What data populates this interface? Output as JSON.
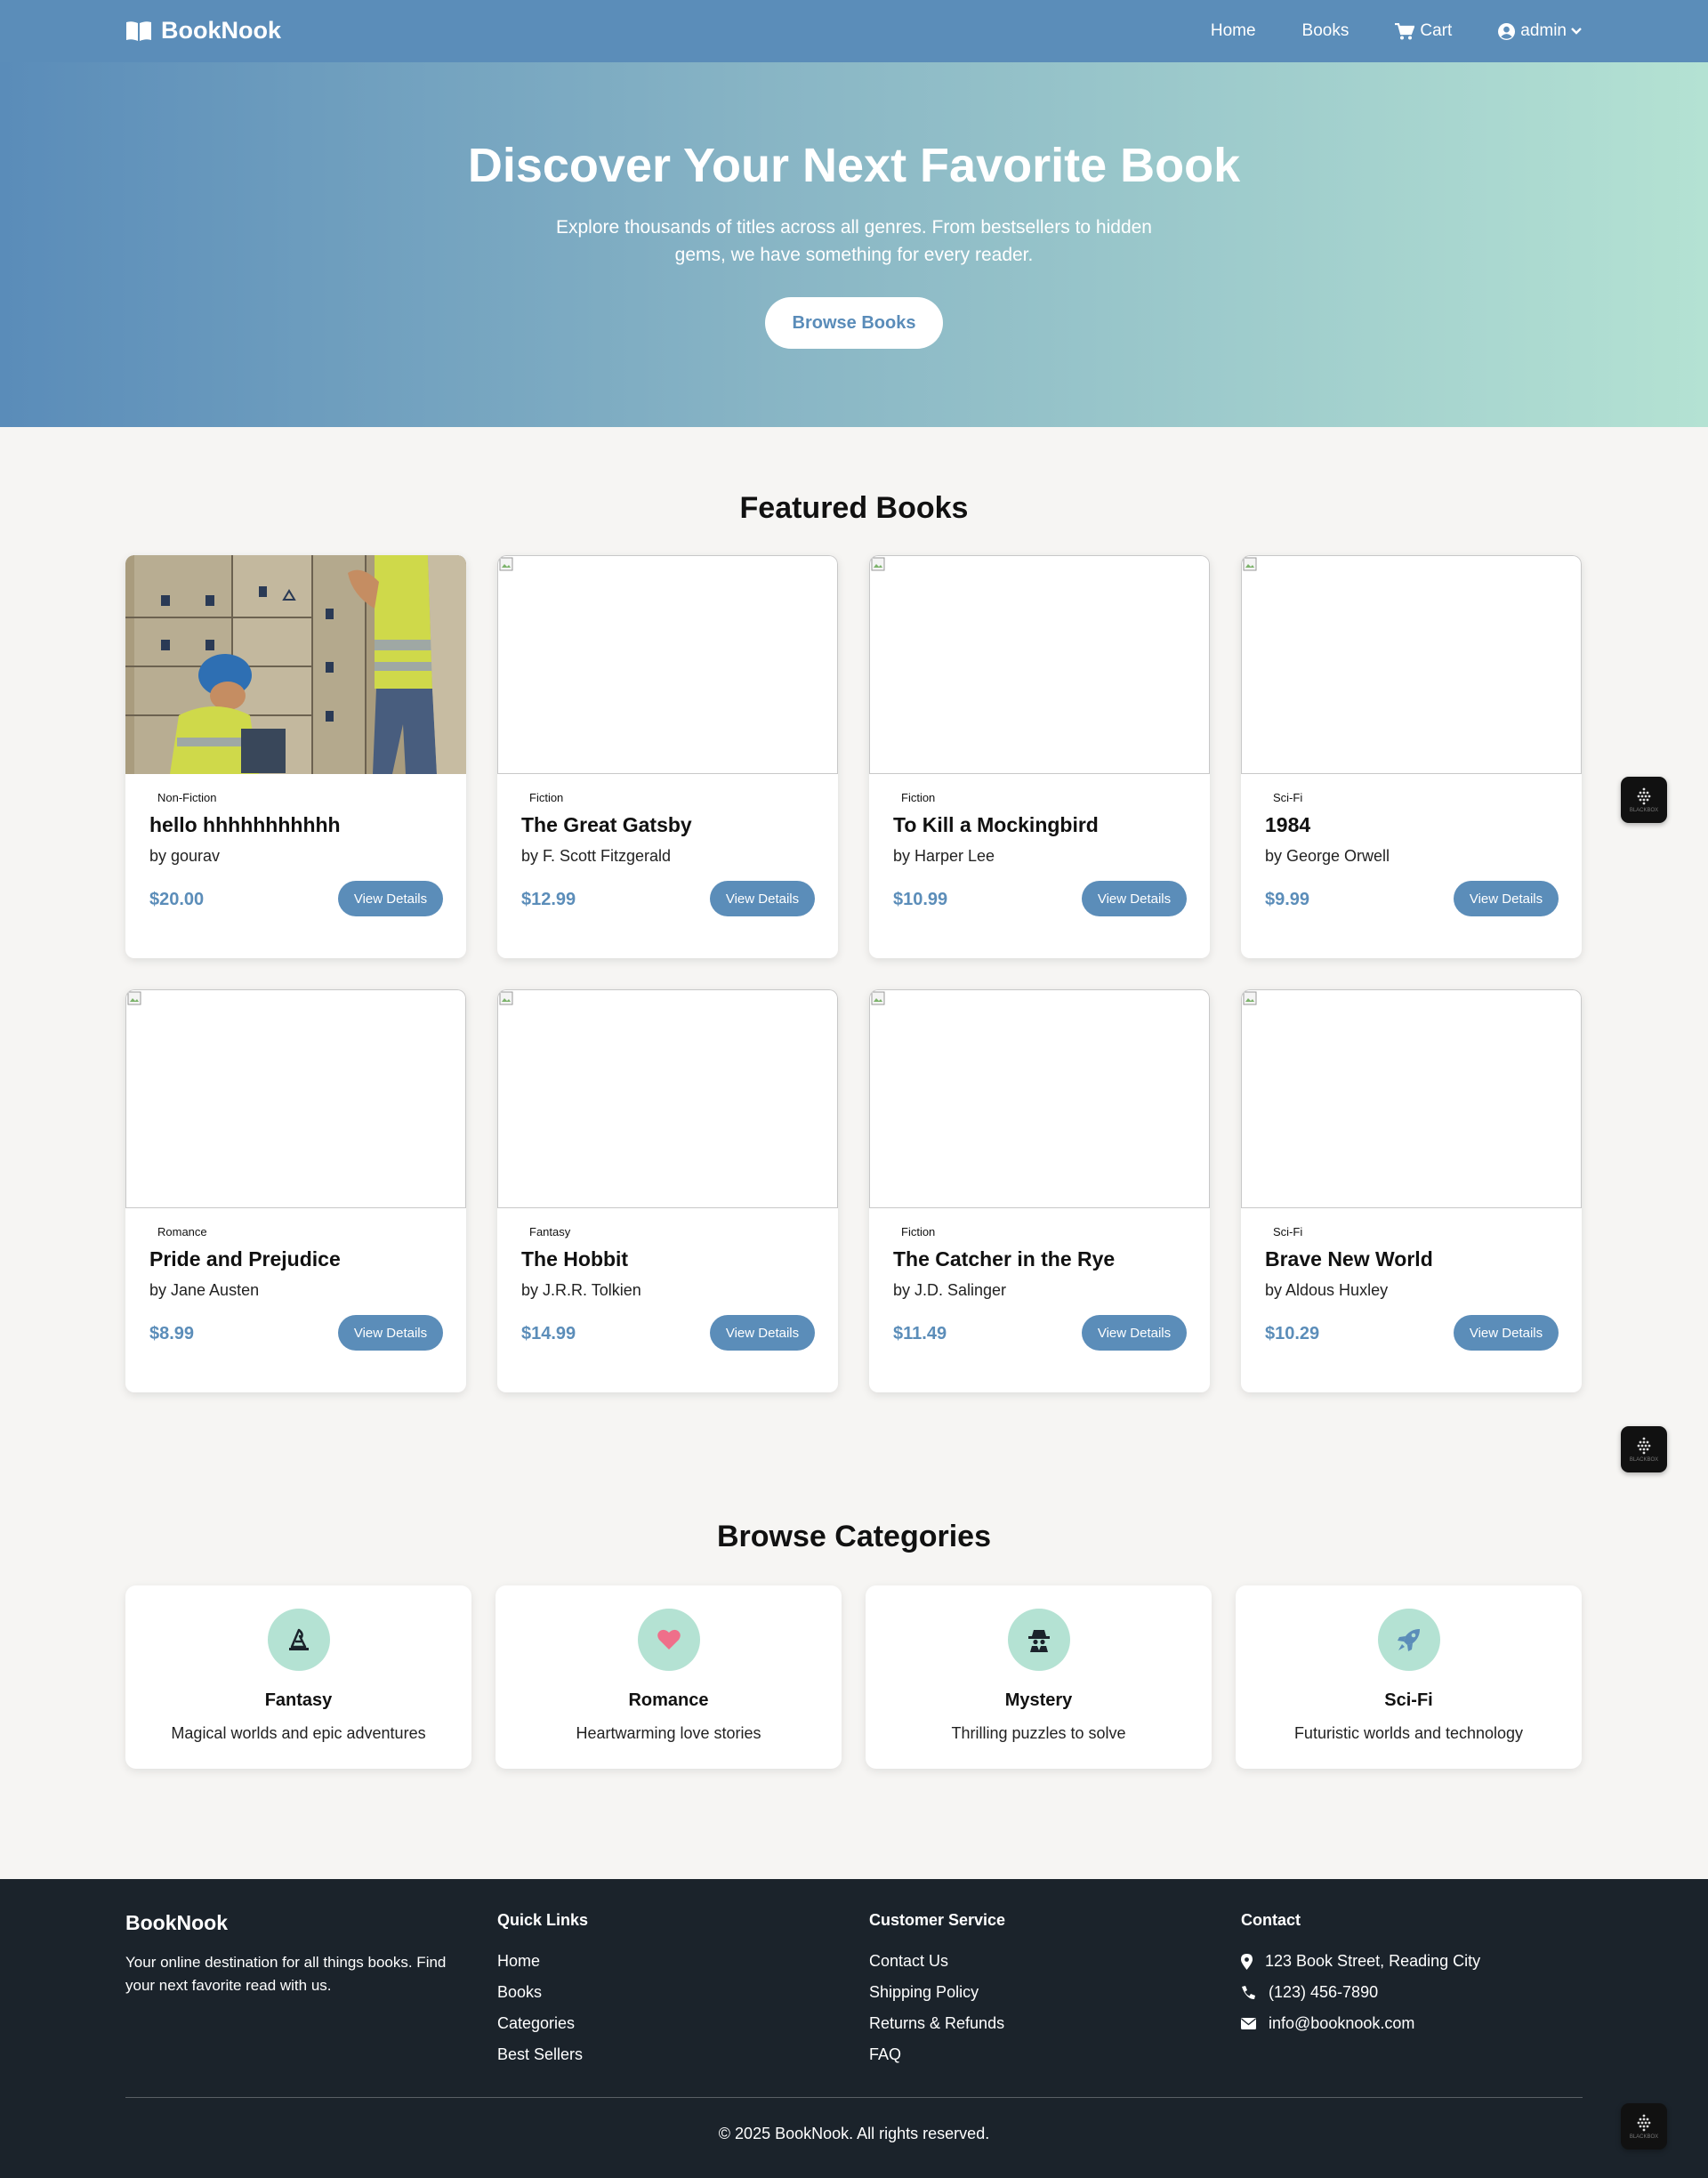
{
  "nav": {
    "brand": "BookNook",
    "links": [
      "Home",
      "Books",
      "Cart",
      "admin"
    ]
  },
  "hero": {
    "title": "Discover Your Next Favorite Book",
    "subtitle": "Explore thousands of titles across all genres. From bestsellers to hidden gems, we have something for every reader.",
    "button": "Browse Books"
  },
  "featured": {
    "title": "Featured Books",
    "books": [
      {
        "genre": "Non-Fiction",
        "title": "hello hhhhhhhhhhh",
        "author": "by gourav",
        "price": "$20.00",
        "button": "View Details"
      },
      {
        "genre": "Fiction",
        "title": "The Great Gatsby",
        "author": "by F. Scott Fitzgerald",
        "price": "$12.99",
        "button": "View Details"
      },
      {
        "genre": "Fiction",
        "title": "To Kill a Mockingbird",
        "author": "by Harper Lee",
        "price": "$10.99",
        "button": "View Details"
      },
      {
        "genre": "Sci-Fi",
        "title": "1984",
        "author": "by George Orwell",
        "price": "$9.99",
        "button": "View Details"
      },
      {
        "genre": "Romance",
        "title": "Pride and Prejudice",
        "author": "by Jane Austen",
        "price": "$8.99",
        "button": "View Details"
      },
      {
        "genre": "Fantasy",
        "title": "The Hobbit",
        "author": "by J.R.R. Tolkien",
        "price": "$14.99",
        "button": "View Details"
      },
      {
        "genre": "Fiction",
        "title": "The Catcher in the Rye",
        "author": "by J.D. Salinger",
        "price": "$11.49",
        "button": "View Details"
      },
      {
        "genre": "Sci-Fi",
        "title": "Brave New World",
        "author": "by Aldous Huxley",
        "price": "$10.29",
        "button": "View Details"
      }
    ]
  },
  "categories": {
    "title": "Browse Categories",
    "items": [
      {
        "icon": "wizard-hat-icon",
        "name": "Fantasy",
        "desc": "Magical worlds and epic adventures"
      },
      {
        "icon": "heart-icon",
        "name": "Romance",
        "desc": "Heartwarming love stories"
      },
      {
        "icon": "detective-icon",
        "name": "Mystery",
        "desc": "Thrilling puzzles to solve"
      },
      {
        "icon": "rocket-icon",
        "name": "Sci-Fi",
        "desc": "Futuristic worlds and technology"
      }
    ]
  },
  "footer": {
    "brand": "BookNook",
    "about": "Your online destination for all things books. Find your next favorite read with us.",
    "quick_links": {
      "title": "Quick Links",
      "items": [
        "Home",
        "Books",
        "Categories",
        "Best Sellers"
      ]
    },
    "service": {
      "title": "Customer Service",
      "items": [
        "Contact Us",
        "Shipping Policy",
        "Returns & Refunds",
        "FAQ"
      ]
    },
    "contact": {
      "title": "Contact",
      "address": "123 Book Street, Reading City",
      "phone": "(123) 456-7890",
      "email": "info@booknook.com"
    },
    "copyright": "© 2025 BookNook. All rights reserved."
  },
  "widget": {
    "label": "BLACKBOX"
  },
  "colors": {
    "primary": "#5b8db9",
    "accent": "#b4e2d3",
    "footer": "#1b232b",
    "background": "#f6f5f3"
  }
}
